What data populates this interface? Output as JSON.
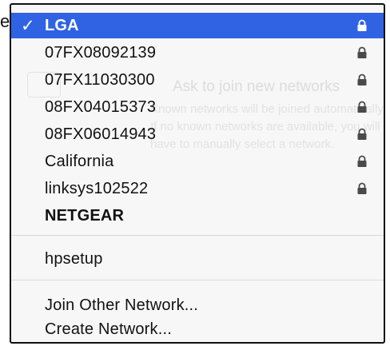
{
  "background_stub": "e",
  "menu": {
    "selected_network": {
      "check": "✓",
      "label": "LGA",
      "secured": true,
      "icon": "lock-icon"
    },
    "networks": [
      {
        "label": "07FX08092139",
        "secured": true,
        "icon": "lock-icon"
      },
      {
        "label": "07FX11030300",
        "secured": true,
        "icon": "lock-icon"
      },
      {
        "label": "08FX04015373",
        "secured": true,
        "icon": "lock-icon"
      },
      {
        "label": "08FX06014943",
        "secured": true,
        "icon": "lock-icon"
      },
      {
        "label": "California",
        "secured": true,
        "icon": "lock-icon"
      },
      {
        "label": "linksys102522",
        "secured": true,
        "icon": "lock-icon"
      },
      {
        "label": "NETGEAR",
        "secured": false
      }
    ],
    "adhoc_networks": [
      {
        "label": "hpsetup"
      }
    ],
    "actions": {
      "join_other": "Join Other Network...",
      "create_network": "Create Network..."
    }
  },
  "background_panel": {
    "title": "Ask to join new networks",
    "lines": [
      "Known networks will be joined automatically.",
      "If no known networks are available, you will",
      "have to manually select a network."
    ]
  },
  "colors": {
    "selection": "#2f63e3",
    "menu_background": "#f7f7f7",
    "text": "#111111",
    "lock": "#4a4a4a"
  }
}
